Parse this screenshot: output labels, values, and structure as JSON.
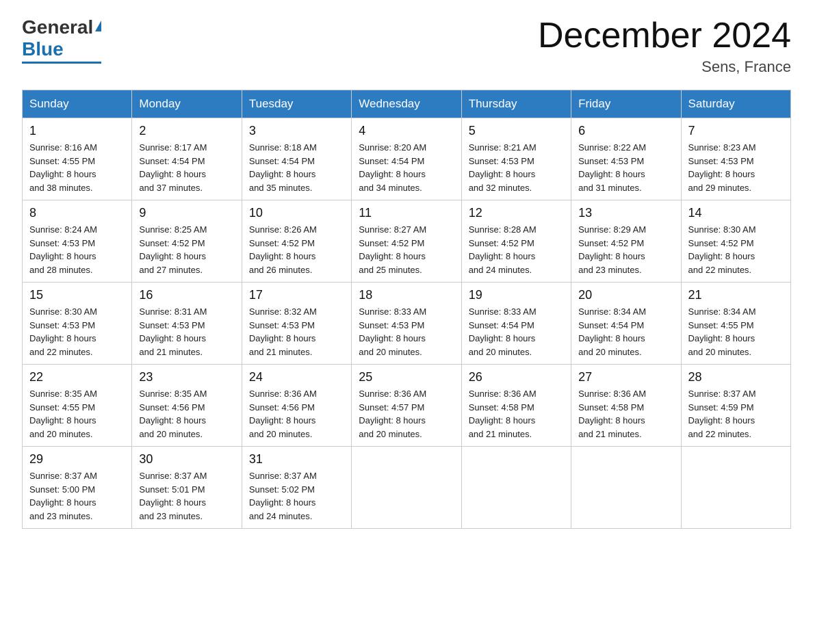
{
  "header": {
    "logo_general": "General",
    "logo_blue": "Blue",
    "title": "December 2024",
    "location": "Sens, France"
  },
  "days_of_week": [
    "Sunday",
    "Monday",
    "Tuesday",
    "Wednesday",
    "Thursday",
    "Friday",
    "Saturday"
  ],
  "weeks": [
    [
      {
        "day": "1",
        "info": "Sunrise: 8:16 AM\nSunset: 4:55 PM\nDaylight: 8 hours\nand 38 minutes."
      },
      {
        "day": "2",
        "info": "Sunrise: 8:17 AM\nSunset: 4:54 PM\nDaylight: 8 hours\nand 37 minutes."
      },
      {
        "day": "3",
        "info": "Sunrise: 8:18 AM\nSunset: 4:54 PM\nDaylight: 8 hours\nand 35 minutes."
      },
      {
        "day": "4",
        "info": "Sunrise: 8:20 AM\nSunset: 4:54 PM\nDaylight: 8 hours\nand 34 minutes."
      },
      {
        "day": "5",
        "info": "Sunrise: 8:21 AM\nSunset: 4:53 PM\nDaylight: 8 hours\nand 32 minutes."
      },
      {
        "day": "6",
        "info": "Sunrise: 8:22 AM\nSunset: 4:53 PM\nDaylight: 8 hours\nand 31 minutes."
      },
      {
        "day": "7",
        "info": "Sunrise: 8:23 AM\nSunset: 4:53 PM\nDaylight: 8 hours\nand 29 minutes."
      }
    ],
    [
      {
        "day": "8",
        "info": "Sunrise: 8:24 AM\nSunset: 4:53 PM\nDaylight: 8 hours\nand 28 minutes."
      },
      {
        "day": "9",
        "info": "Sunrise: 8:25 AM\nSunset: 4:52 PM\nDaylight: 8 hours\nand 27 minutes."
      },
      {
        "day": "10",
        "info": "Sunrise: 8:26 AM\nSunset: 4:52 PM\nDaylight: 8 hours\nand 26 minutes."
      },
      {
        "day": "11",
        "info": "Sunrise: 8:27 AM\nSunset: 4:52 PM\nDaylight: 8 hours\nand 25 minutes."
      },
      {
        "day": "12",
        "info": "Sunrise: 8:28 AM\nSunset: 4:52 PM\nDaylight: 8 hours\nand 24 minutes."
      },
      {
        "day": "13",
        "info": "Sunrise: 8:29 AM\nSunset: 4:52 PM\nDaylight: 8 hours\nand 23 minutes."
      },
      {
        "day": "14",
        "info": "Sunrise: 8:30 AM\nSunset: 4:52 PM\nDaylight: 8 hours\nand 22 minutes."
      }
    ],
    [
      {
        "day": "15",
        "info": "Sunrise: 8:30 AM\nSunset: 4:53 PM\nDaylight: 8 hours\nand 22 minutes."
      },
      {
        "day": "16",
        "info": "Sunrise: 8:31 AM\nSunset: 4:53 PM\nDaylight: 8 hours\nand 21 minutes."
      },
      {
        "day": "17",
        "info": "Sunrise: 8:32 AM\nSunset: 4:53 PM\nDaylight: 8 hours\nand 21 minutes."
      },
      {
        "day": "18",
        "info": "Sunrise: 8:33 AM\nSunset: 4:53 PM\nDaylight: 8 hours\nand 20 minutes."
      },
      {
        "day": "19",
        "info": "Sunrise: 8:33 AM\nSunset: 4:54 PM\nDaylight: 8 hours\nand 20 minutes."
      },
      {
        "day": "20",
        "info": "Sunrise: 8:34 AM\nSunset: 4:54 PM\nDaylight: 8 hours\nand 20 minutes."
      },
      {
        "day": "21",
        "info": "Sunrise: 8:34 AM\nSunset: 4:55 PM\nDaylight: 8 hours\nand 20 minutes."
      }
    ],
    [
      {
        "day": "22",
        "info": "Sunrise: 8:35 AM\nSunset: 4:55 PM\nDaylight: 8 hours\nand 20 minutes."
      },
      {
        "day": "23",
        "info": "Sunrise: 8:35 AM\nSunset: 4:56 PM\nDaylight: 8 hours\nand 20 minutes."
      },
      {
        "day": "24",
        "info": "Sunrise: 8:36 AM\nSunset: 4:56 PM\nDaylight: 8 hours\nand 20 minutes."
      },
      {
        "day": "25",
        "info": "Sunrise: 8:36 AM\nSunset: 4:57 PM\nDaylight: 8 hours\nand 20 minutes."
      },
      {
        "day": "26",
        "info": "Sunrise: 8:36 AM\nSunset: 4:58 PM\nDaylight: 8 hours\nand 21 minutes."
      },
      {
        "day": "27",
        "info": "Sunrise: 8:36 AM\nSunset: 4:58 PM\nDaylight: 8 hours\nand 21 minutes."
      },
      {
        "day": "28",
        "info": "Sunrise: 8:37 AM\nSunset: 4:59 PM\nDaylight: 8 hours\nand 22 minutes."
      }
    ],
    [
      {
        "day": "29",
        "info": "Sunrise: 8:37 AM\nSunset: 5:00 PM\nDaylight: 8 hours\nand 23 minutes."
      },
      {
        "day": "30",
        "info": "Sunrise: 8:37 AM\nSunset: 5:01 PM\nDaylight: 8 hours\nand 23 minutes."
      },
      {
        "day": "31",
        "info": "Sunrise: 8:37 AM\nSunset: 5:02 PM\nDaylight: 8 hours\nand 24 minutes."
      },
      {
        "day": "",
        "info": ""
      },
      {
        "day": "",
        "info": ""
      },
      {
        "day": "",
        "info": ""
      },
      {
        "day": "",
        "info": ""
      }
    ]
  ]
}
